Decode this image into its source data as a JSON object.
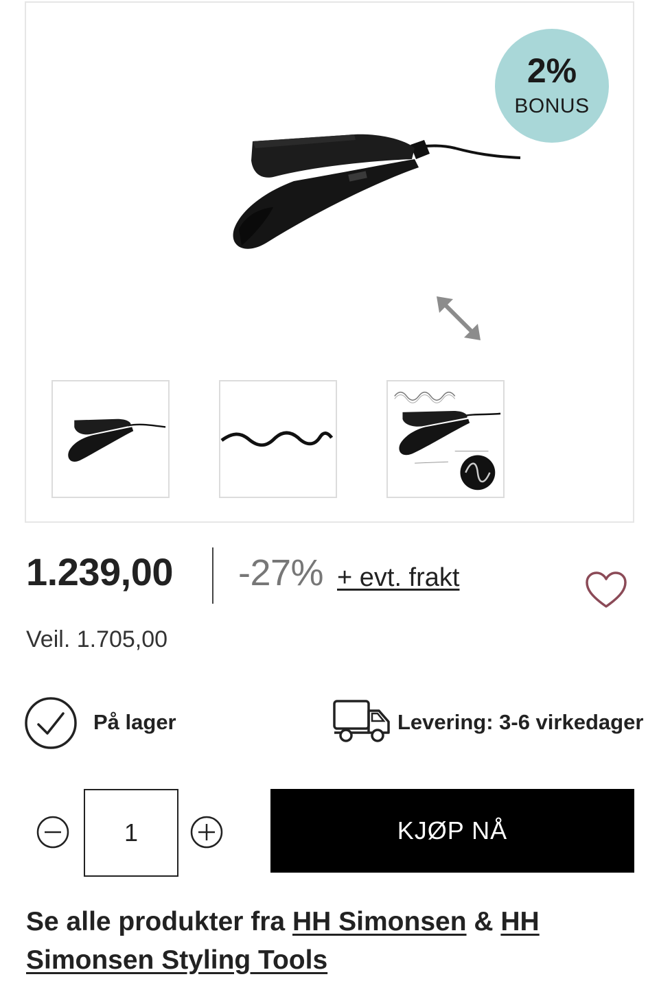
{
  "gallery": {
    "bonus": {
      "percent": "2%",
      "label": "BONUS",
      "color": "#a9d7d8"
    },
    "main_image_alt": "product-main-image",
    "expand_icon": "expand-diagonal-icon",
    "thumbnails": [
      {
        "name": "thumbnail-product"
      },
      {
        "name": "thumbnail-wave"
      },
      {
        "name": "thumbnail-product-detail"
      }
    ]
  },
  "pricing": {
    "price": "1.239,00",
    "discount": "-27%",
    "shipping": "+ evt. frakt",
    "rrp": "Veil. 1.705,00"
  },
  "wishlist_icon": "heart-outline-icon",
  "availability": {
    "stock": "På lager",
    "stock_icon": "check-circle-icon",
    "delivery": "Levering: 3-6 virkedager",
    "delivery_icon": "truck-icon"
  },
  "purchase": {
    "quantity": "1",
    "buy_label": "KJØP NÅ",
    "minus_icon": "minus-circle-icon",
    "plus_icon": "plus-circle-icon"
  },
  "brands": {
    "prefix": "Se alle produkter fra",
    "brand_1": "HH Simonsen",
    "separator": "&",
    "brand_2": "HH Simonsen Styling Tools"
  },
  "colors": {
    "wishlist": "#8b4a57",
    "button_bg": "#000000",
    "text": "#222222"
  }
}
